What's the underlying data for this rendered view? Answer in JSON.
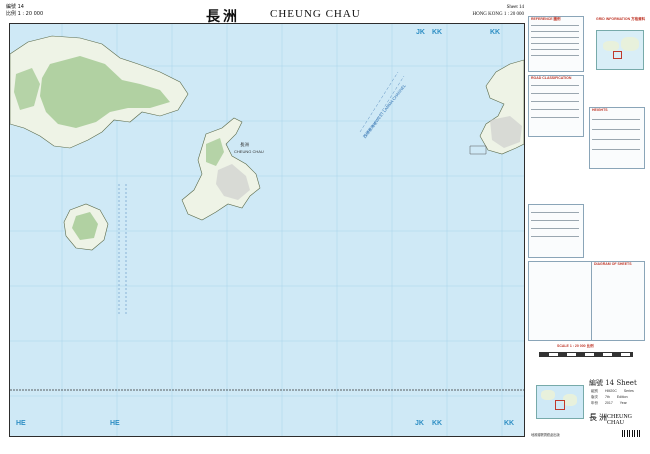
{
  "header": {
    "left_line1": "編號 14",
    "left_line2": "比例 1 : 20 000",
    "title_cn": "長洲",
    "title_en": "CHEUNG CHAU",
    "right_line1": "Sheet 14",
    "right_line2": "HONG KONG 1 : 20 000"
  },
  "grid_labels": {
    "top_jk": "JK",
    "top_kk": "KK",
    "bottom_he": "HE",
    "bottom_he2": "HE",
    "bottom_jk": "JK",
    "bottom_kk": "KK"
  },
  "places": {
    "cheung_chau_cn": "長洲",
    "cheung_chau_en": "CHEUNG CHAU",
    "channel_cn": "西博寮海峽",
    "channel_en": "WEST LAMMA CHANNEL"
  },
  "legend": {
    "head1": "REFERENCE 圖例",
    "head2": "GRID INFORMATION 方格資料",
    "head3": "ROAD CLASSIFICATION",
    "head4": "HEIGHTS",
    "head5": "SCALE 1 : 20 000 比例",
    "head6": "DIAGRAM OF SHEETS",
    "sheet_title": "編號 14 Sheet",
    "meta_series_cn": "組別",
    "meta_series_val": "HM20C",
    "meta_series_en": "Series",
    "meta_edition_cn": "版次",
    "meta_edition_val": "7th",
    "meta_edition_en": "Edition",
    "meta_year_cn": "年份",
    "meta_year_val": "2017",
    "meta_year_en": "Year",
    "footer_cn": "長洲",
    "footer_en": "CHEUNG CHAU",
    "footer_note": "地政總署測繪處出版"
  },
  "colors": {
    "sea": "#cfe9f6",
    "land": "#eef3e6",
    "forest": "#9cc58b",
    "grid": "#6fb3d8",
    "accent_red": "#c0392b"
  }
}
